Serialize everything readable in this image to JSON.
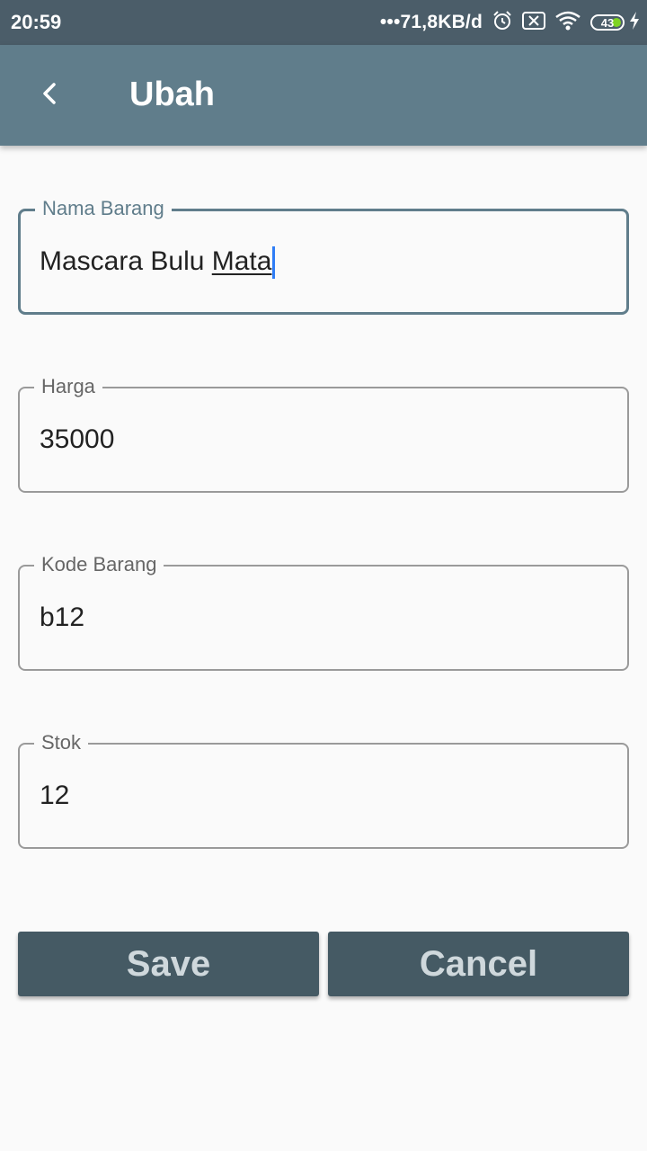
{
  "status_bar": {
    "time": "20:59",
    "net_speed": "•••71,8KB/d",
    "battery_level": "43",
    "icons": [
      "alarm-icon",
      "sim-off-icon",
      "wifi-icon",
      "battery-icon",
      "charging-icon"
    ]
  },
  "app_bar": {
    "title": "Ubah",
    "back_icon": "arrow-back-icon"
  },
  "form": {
    "nama_barang": {
      "label": "Nama Barang",
      "value_prefix": "Mascara Bulu ",
      "value_composing": "Mata"
    },
    "harga": {
      "label": "Harga",
      "value": "35000"
    },
    "kode_barang": {
      "label": "Kode Barang",
      "value": "b12"
    },
    "stok": {
      "label": "Stok",
      "value": "12"
    }
  },
  "actions": {
    "save_label": "Save",
    "cancel_label": "Cancel"
  },
  "colors": {
    "status_bar": "#4b5d69",
    "app_bar": "#607d8b",
    "button": "#455a64",
    "button_text": "#cfd8dc",
    "focus_border": "#607d8b",
    "cursor": "#2f7df6"
  }
}
